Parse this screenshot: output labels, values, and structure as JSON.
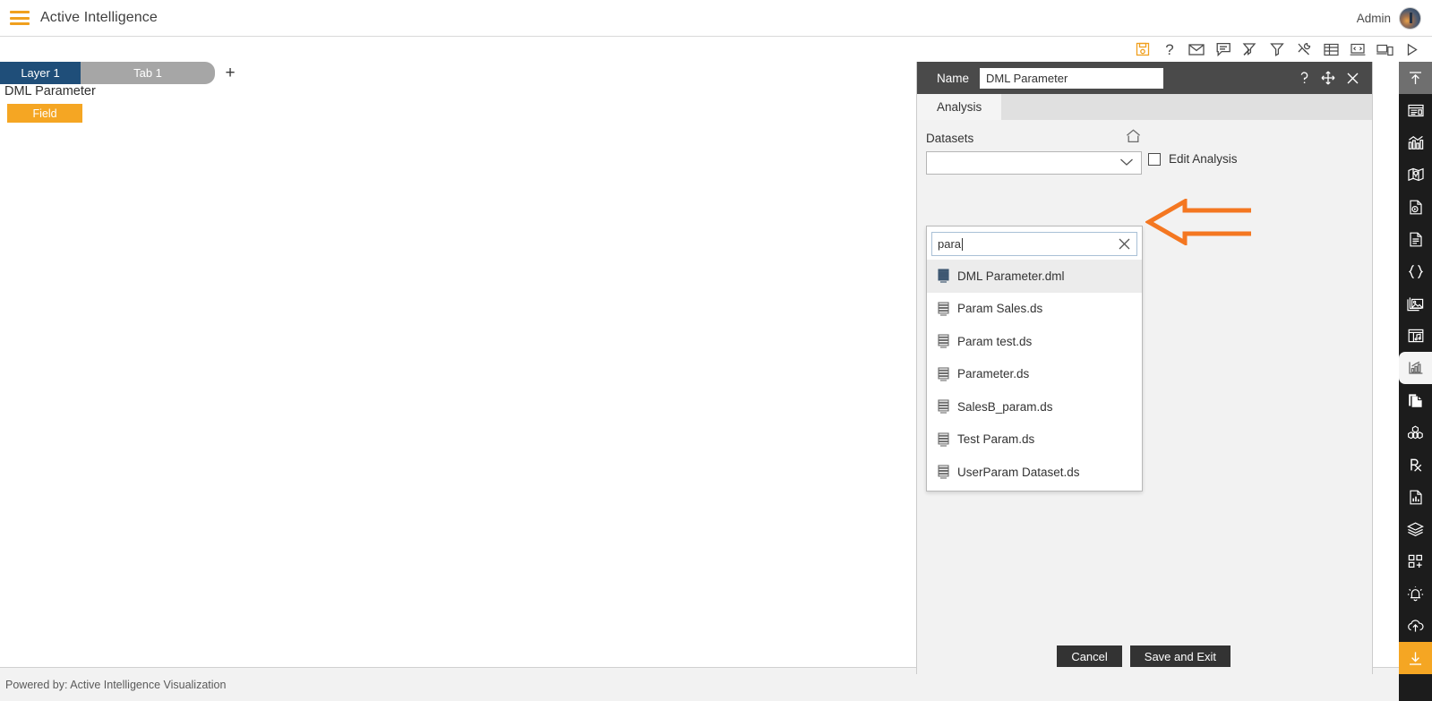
{
  "app": {
    "title": "Active Intelligence",
    "user_label": "Admin",
    "menu_icon": "hamburger-icon",
    "avatar_icon": "user-avatar"
  },
  "toolbar": {
    "icons": [
      {
        "name": "save-icon",
        "accent": true
      },
      {
        "name": "help-icon",
        "accent": false
      },
      {
        "name": "mail-icon",
        "accent": false
      },
      {
        "name": "comment-icon",
        "accent": false
      },
      {
        "name": "clear-filter-icon",
        "accent": false
      },
      {
        "name": "filter-icon",
        "accent": false
      },
      {
        "name": "tools-icon",
        "accent": false
      },
      {
        "name": "table-icon",
        "accent": false
      },
      {
        "name": "code-icon",
        "accent": false
      },
      {
        "name": "devices-icon",
        "accent": false
      },
      {
        "name": "play-icon",
        "accent": false
      }
    ]
  },
  "tabs": {
    "layer_label": "Layer 1",
    "page_label": "Tab 1",
    "add_label": "+"
  },
  "canvas": {
    "widget_title": "DML Parameter",
    "field_chip_label": "Field"
  },
  "footer": {
    "text": "Powered by: Active Intelligence Visualization"
  },
  "panel": {
    "name_label": "Name",
    "name_value": "DML Parameter",
    "header_icons": [
      {
        "name": "panel-help-icon"
      },
      {
        "name": "panel-move-icon"
      },
      {
        "name": "panel-close-icon"
      }
    ],
    "tabs": [
      {
        "label": "Analysis",
        "active": true
      }
    ],
    "datasets_label": "Datasets",
    "home_icon": "home-icon",
    "dataset_selected": "",
    "dataset_placeholder": "",
    "edit_analysis_label": "Edit Analysis",
    "edit_analysis_checked": false,
    "dropdown": {
      "search_value": "para",
      "search_placeholder": "",
      "clear_icon": "clear-search-icon",
      "items": [
        {
          "label": "DML Parameter.dml",
          "icon": "dataset-icon",
          "selected": true
        },
        {
          "label": "Param Sales.ds",
          "icon": "dataset-icon",
          "selected": false
        },
        {
          "label": "Param test.ds",
          "icon": "dataset-icon",
          "selected": false
        },
        {
          "label": "Parameter.ds",
          "icon": "dataset-icon",
          "selected": false
        },
        {
          "label": "SalesB_param.ds",
          "icon": "dataset-icon",
          "selected": false
        },
        {
          "label": "Test Param.ds",
          "icon": "dataset-icon",
          "selected": false
        },
        {
          "label": "UserParam Dataset.ds",
          "icon": "dataset-icon",
          "selected": false
        }
      ]
    },
    "cancel_label": "Cancel",
    "save_label": "Save and Exit"
  },
  "rail": {
    "items": [
      {
        "name": "collapse-up-icon",
        "state": "grey"
      },
      {
        "name": "card-icon",
        "state": "normal"
      },
      {
        "name": "chart-icon",
        "state": "normal"
      },
      {
        "name": "map-icon",
        "state": "normal"
      },
      {
        "name": "document-image-icon",
        "state": "normal"
      },
      {
        "name": "text-document-icon",
        "state": "normal"
      },
      {
        "name": "braces-icon",
        "state": "normal"
      },
      {
        "name": "image-gallery-icon",
        "state": "normal"
      },
      {
        "name": "layout-note-icon",
        "state": "normal"
      },
      {
        "name": "analytics-icon",
        "state": "white"
      },
      {
        "name": "copy-pages-icon",
        "state": "normal"
      },
      {
        "name": "cubes-icon",
        "state": "normal"
      },
      {
        "name": "rx-icon",
        "state": "normal"
      },
      {
        "name": "report-icon",
        "state": "normal"
      },
      {
        "name": "layers-icon",
        "state": "normal"
      },
      {
        "name": "add-widget-icon",
        "state": "normal"
      },
      {
        "name": "alert-bell-icon",
        "state": "normal"
      },
      {
        "name": "cloud-upload-icon",
        "state": "normal"
      },
      {
        "name": "download-icon",
        "state": "orange"
      }
    ]
  },
  "annotation": {
    "arrow_icon": "left-arrow-annotation",
    "arrow_color": "#F47721"
  }
}
